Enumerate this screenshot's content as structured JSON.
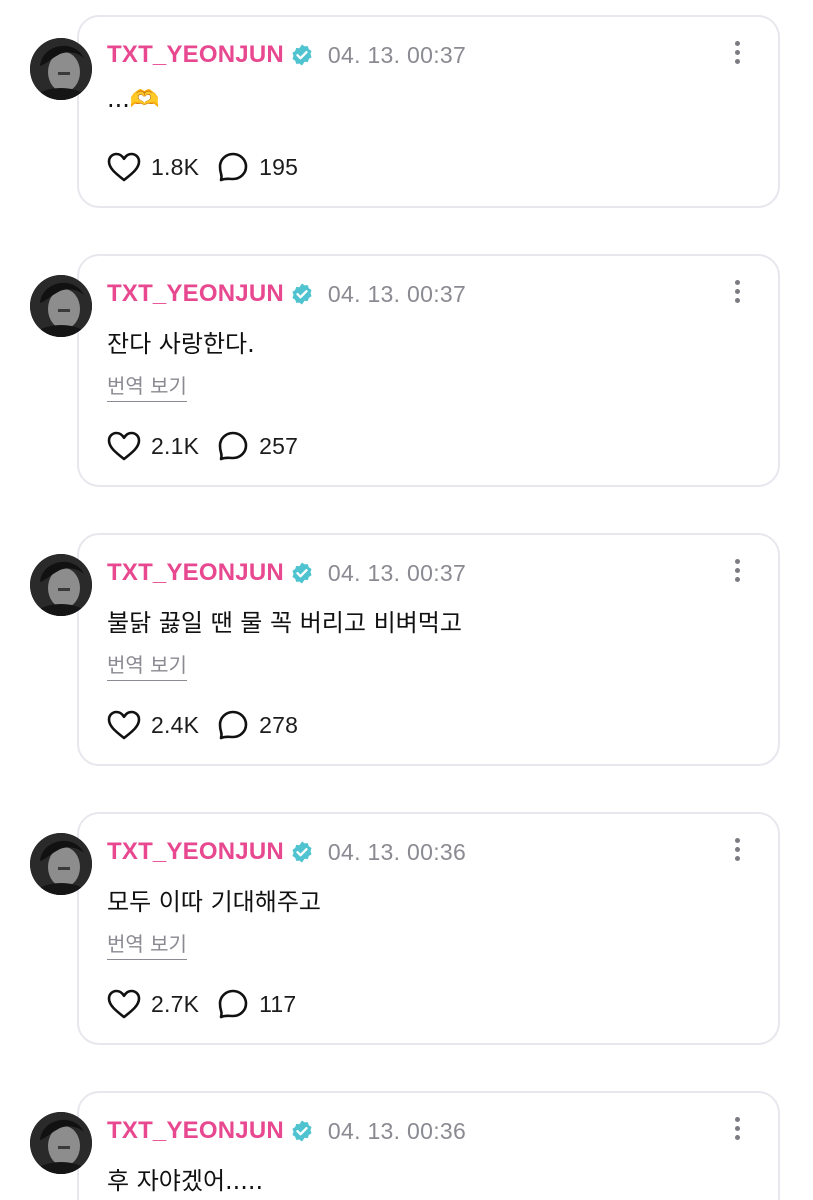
{
  "posts": [
    {
      "username": "TXT_YEONJUN",
      "timestamp": "04. 13. 00:37",
      "text": "...🫶",
      "translate_label": "",
      "likes": "1.8K",
      "comments": "195"
    },
    {
      "username": "TXT_YEONJUN",
      "timestamp": "04. 13. 00:37",
      "text": "잔다 사랑한다.",
      "translate_label": "번역 보기",
      "likes": "2.1K",
      "comments": "257"
    },
    {
      "username": "TXT_YEONJUN",
      "timestamp": "04. 13. 00:37",
      "text": "불닭 끓일 땐 물 꼭 버리고 비벼먹고",
      "translate_label": "번역 보기",
      "likes": "2.4K",
      "comments": "278"
    },
    {
      "username": "TXT_YEONJUN",
      "timestamp": "04. 13. 00:36",
      "text": "모두 이따 기대해주고",
      "translate_label": "번역 보기",
      "likes": "2.7K",
      "comments": "117"
    },
    {
      "username": "TXT_YEONJUN",
      "timestamp": "04. 13. 00:36",
      "text": "후 자야겠어.....",
      "translate_label": "",
      "likes": "",
      "comments": ""
    }
  ],
  "icons": {
    "like": "heart-outline-icon",
    "comment": "speech-bubble-icon",
    "more": "vertical-ellipsis-icon",
    "verified": "verified-badge-icon"
  },
  "colors": {
    "username": "#e8488f",
    "verified_badge": "#4fc3cf",
    "timestamp": "#8a8a92",
    "card_border": "#e7e7ee"
  }
}
